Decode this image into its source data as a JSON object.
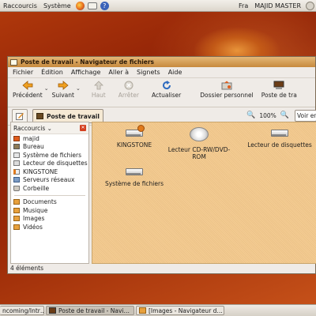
{
  "topbar": {
    "menus": [
      "Raccourcis",
      "Système"
    ],
    "keyboard_layout": "Fra",
    "user": "MAJID MASTER"
  },
  "window": {
    "title": "Poste de travail - Navigateur de fichiers",
    "menu": [
      "Fichier",
      "Édition",
      "Affichage",
      "Aller à",
      "Signets",
      "Aide"
    ],
    "toolbar": {
      "back": "Précédent",
      "forward": "Suivant",
      "up": "Haut",
      "stop": "Arrêter",
      "reload": "Actualiser",
      "home": "Dossier personnel",
      "computer": "Poste de tra"
    },
    "location": {
      "path_button": "Poste de travail",
      "zoom": "100%",
      "view_select": "Voir en"
    },
    "sidebar": {
      "header": "Raccourcis",
      "items": [
        {
          "label": "majid",
          "icon": "home-icon"
        },
        {
          "label": "Bureau",
          "icon": "desktop-icon"
        },
        {
          "label": "Système de fichiers",
          "icon": "harddisk-icon"
        },
        {
          "label": "Lecteur de disquettes",
          "icon": "floppy-icon"
        },
        {
          "label": "KINGSTONE",
          "icon": "usb-icon"
        },
        {
          "label": "Serveurs réseaux",
          "icon": "network-icon"
        },
        {
          "label": "Corbeille",
          "icon": "trash-icon"
        }
      ],
      "bookmarks": [
        {
          "label": "Documents",
          "icon": "folder-icon"
        },
        {
          "label": "Musique",
          "icon": "folder-icon"
        },
        {
          "label": "Images",
          "icon": "folder-icon"
        },
        {
          "label": "Vidéos",
          "icon": "folder-icon"
        }
      ]
    },
    "files": [
      {
        "name": "KINGSTONE",
        "icon": "usb-drive-icon"
      },
      {
        "name": "Lecteur CD-RW/DVD-ROM",
        "icon": "cdrom-icon"
      },
      {
        "name": "Lecteur de disquettes",
        "icon": "floppy-drive-icon"
      },
      {
        "name": "Système de fichiers",
        "icon": "harddisk-icon"
      }
    ],
    "status": "4 éléments"
  },
  "taskbar": {
    "tasks": [
      "ncoming/Intr…",
      "Poste de travail - Navi…",
      "[Images - Navigateur d…"
    ]
  }
}
